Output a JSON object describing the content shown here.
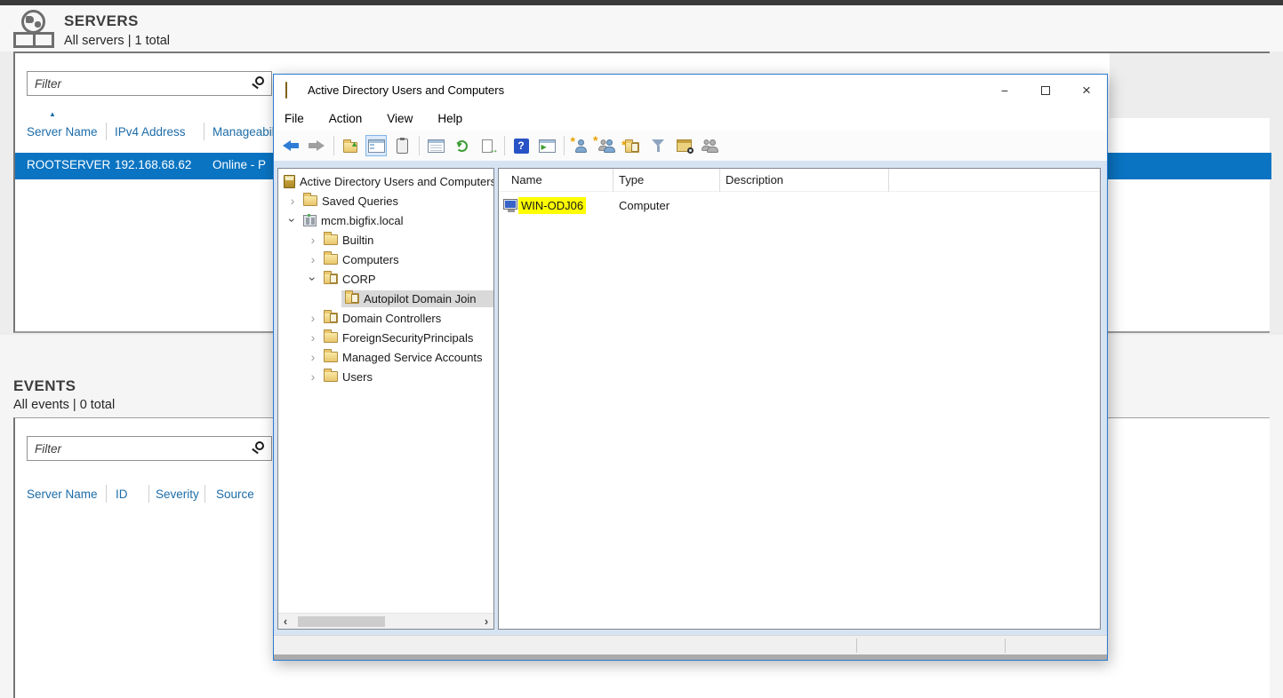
{
  "server_manager": {
    "servers": {
      "title": "SERVERS",
      "subtitle": "All servers | 1 total",
      "filter_placeholder": "Filter",
      "columns": [
        "Server Name",
        "IPv4 Address",
        "Manageability"
      ],
      "sort_indicator": "ascending",
      "rows": [
        {
          "server_name": "ROOTSERVER",
          "ipv4_address": "192.168.68.62",
          "manageability": "Online - P"
        }
      ]
    },
    "events": {
      "title": "EVENTS",
      "subtitle": "All events | 0 total",
      "filter_placeholder": "Filter",
      "columns": [
        "Server Name",
        "ID",
        "Severity",
        "Source"
      ]
    }
  },
  "ad_window": {
    "title": "Active Directory Users and Computers",
    "window_controls": {
      "minimize": "−",
      "close": "×"
    },
    "menu": [
      "File",
      "Action",
      "View",
      "Help"
    ],
    "toolbar_icons": [
      "back",
      "forward",
      "up-one-level",
      "show-console-tree",
      "clipboard",
      "properties",
      "refresh",
      "export-list",
      "help",
      "show-window",
      "new-user",
      "new-group",
      "new-organizational-unit",
      "filter",
      "find",
      "delegate-control"
    ],
    "tree": [
      {
        "label": "Active Directory Users and Computers"
      },
      {
        "label": "Saved Queries"
      },
      {
        "label": "mcm.bigfix.local"
      },
      {
        "label": "Builtin"
      },
      {
        "label": "Computers"
      },
      {
        "label": "CORP"
      },
      {
        "label": "Autopilot Domain Join"
      },
      {
        "label": "Domain Controllers"
      },
      {
        "label": "ForeignSecurityPrincipals"
      },
      {
        "label": "Managed Service Accounts"
      },
      {
        "label": "Users"
      }
    ],
    "list": {
      "columns": [
        "Name",
        "Type",
        "Description"
      ],
      "rows": [
        {
          "name": "WIN-ODJ06",
          "type": "Computer",
          "description": ""
        }
      ]
    },
    "scrollbar": {
      "left_arrow": "‹",
      "right_arrow": "›"
    }
  },
  "colors": {
    "selected_row_blue": "#0a74c2",
    "column_header_blue": "#1c6ca8",
    "window_border_blue": "#2b7cd0",
    "name_highlight_yellow": "#ffff00",
    "tree_selected_gray": "#d9d9d9",
    "top_bar_dark": "#3a3a3a"
  }
}
